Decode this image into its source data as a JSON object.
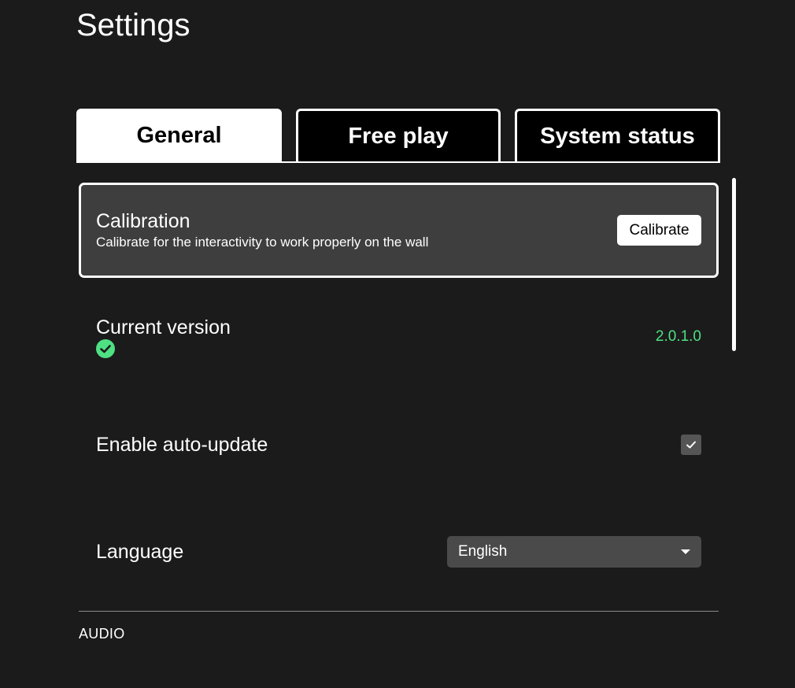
{
  "page": {
    "title": "Settings"
  },
  "tabs": [
    {
      "label": "General",
      "active": true
    },
    {
      "label": "Free play",
      "active": false
    },
    {
      "label": "System status",
      "active": false
    }
  ],
  "calibration": {
    "title": "Calibration",
    "description": "Calibrate for the interactivity to work properly on the wall",
    "button_label": "Calibrate"
  },
  "version": {
    "title": "Current version",
    "value": "2.0.1.0",
    "status_icon": "check-circle-icon",
    "status_color": "#4ee083"
  },
  "auto_update": {
    "title": "Enable auto-update",
    "checked": true
  },
  "language": {
    "title": "Language",
    "selected": "English"
  },
  "sections": {
    "audio_label": "AUDIO"
  },
  "colors": {
    "background": "#1b1b1b",
    "active_tab": "#ffffff",
    "highlight_row": "#3e3e3e",
    "accent_green": "#4ee083"
  }
}
